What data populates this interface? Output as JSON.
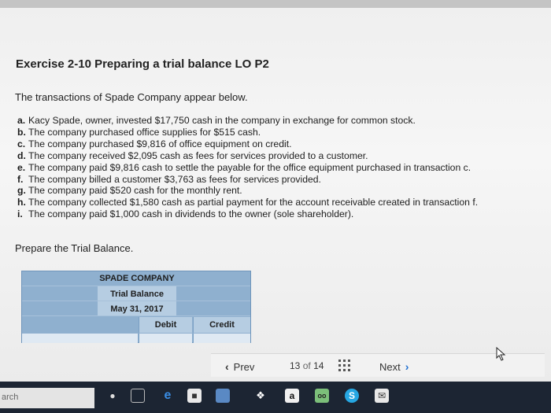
{
  "exercise": {
    "heading": "Exercise 2-10 Preparing a trial balance LO P2",
    "intro": "The transactions of Spade Company appear below.",
    "transactions": [
      {
        "letter": "a.",
        "text": "Kacy Spade, owner, invested $17,750 cash in the company in exchange for common stock."
      },
      {
        "letter": "b.",
        "text": "The company purchased office supplies for $515 cash."
      },
      {
        "letter": "c.",
        "text": "The company purchased $9,816 of office equipment on credit."
      },
      {
        "letter": "d.",
        "text": "The company received $2,095 cash as fees for services provided to a customer."
      },
      {
        "letter": "e.",
        "text": "The company paid $9,816 cash to settle the payable for the office equipment purchased in transaction c."
      },
      {
        "letter": "f.",
        "text": "The company billed a customer $3,763 as fees for services provided."
      },
      {
        "letter": "g.",
        "text": "The company paid $520 cash for the monthly rent."
      },
      {
        "letter": "h.",
        "text": "The company collected $1,580 cash as partial payment for the account receivable created in transaction f."
      },
      {
        "letter": "i.",
        "text": "The company paid $1,000 cash in dividends to the owner (sole shareholder)."
      }
    ],
    "prompt": "Prepare the Trial Balance."
  },
  "trial_balance": {
    "company": "SPADE COMPANY",
    "title": "Trial Balance",
    "date": "May 31, 2017",
    "debit_label": "Debit",
    "credit_label": "Credit"
  },
  "pager": {
    "prev_label": "Prev",
    "current_page": "13",
    "of_label": "of",
    "total_pages": "14",
    "next_label": "Next"
  },
  "taskbar": {
    "search_text": "arch",
    "icons": [
      "microphone-icon",
      "task-view-icon",
      "edge-icon",
      "store-icon",
      "photos-icon",
      "dropbox-icon",
      "amazon-icon",
      "tripadvisor-icon",
      "skype-icon",
      "mail-icon"
    ]
  },
  "colors": {
    "table_header": "#8fb0cf",
    "table_cell": "#b6cde2",
    "link_blue": "#1f6fd0",
    "taskbar": "#1c2533"
  }
}
